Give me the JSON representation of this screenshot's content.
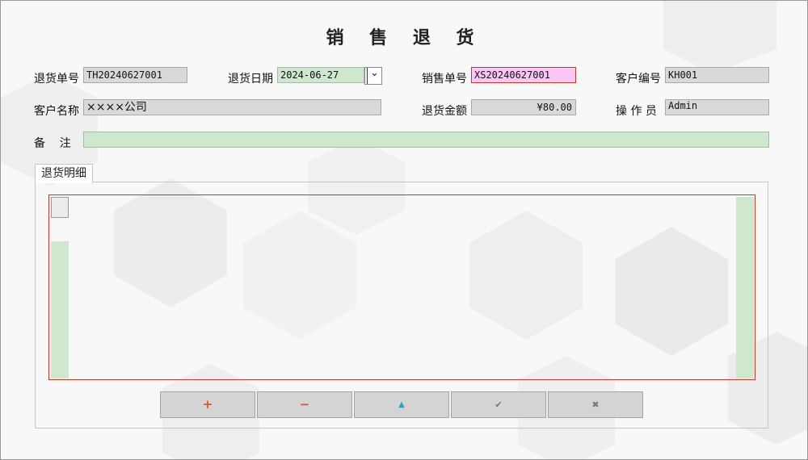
{
  "title": "销 售 退 货",
  "form": {
    "return_no": {
      "label": "退货单号",
      "value": "TH20240627001"
    },
    "return_date": {
      "label": "退货日期",
      "value": "2024-06-27",
      "dropdown_glyph": "⌄"
    },
    "sales_no": {
      "label": "销售单号",
      "value": "XS20240627001"
    },
    "customer_no": {
      "label": "客户编号",
      "value": "KH001"
    },
    "customer_name": {
      "label": "客户名称",
      "value": "××××公司"
    },
    "return_amount": {
      "label": "退货金额",
      "value": "¥80.00"
    },
    "operator": {
      "label": "操 作 员",
      "value": "Admin"
    },
    "remarks": {
      "label": "备    注",
      "value": ""
    }
  },
  "tabs": [
    {
      "label": "退货明细"
    }
  ],
  "toolbar": {
    "add_glyph": "+",
    "remove_glyph": "−",
    "up_glyph": "▲",
    "confirm_glyph": "✔",
    "cancel_glyph": "✖"
  },
  "colors": {
    "readonly_bg": "#d9d9d9",
    "editable_bg": "#cfe7cf",
    "highlight_bg": "#fbc6f3",
    "error_border": "#c0392b",
    "add_icon": "#e0541e",
    "up_icon": "#2aa6b8",
    "disabled_icon": "#777777"
  }
}
